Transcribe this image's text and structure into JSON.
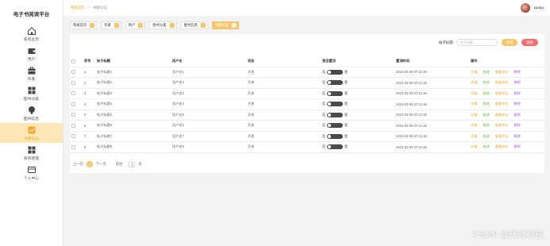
{
  "app_title": "电子书阅读平台",
  "breadcrumb": {
    "home": "系统首页",
    "sep": "/",
    "current": "书圈论坛"
  },
  "user": {
    "name": "xiaoju"
  },
  "sidebar": {
    "items": [
      {
        "label": "系统主页",
        "icon": "home-icon"
      },
      {
        "label": "用户",
        "icon": "wallet-icon"
      },
      {
        "label": "作者",
        "icon": "briefcase-icon"
      },
      {
        "label": "图书分类",
        "icon": "grid-icon"
      },
      {
        "label": "图书信息",
        "icon": "bulb-icon"
      },
      {
        "label": "书圈论坛",
        "icon": "chart-icon"
      },
      {
        "label": "系统管理",
        "icon": "grid-icon"
      },
      {
        "label": "个人中心",
        "icon": "card-icon"
      }
    ]
  },
  "tabs": [
    {
      "label": "系统首页"
    },
    {
      "label": "作者"
    },
    {
      "label": "用户"
    },
    {
      "label": "图书分类"
    },
    {
      "label": "图书信息"
    },
    {
      "label": "书圈论坛"
    }
  ],
  "search": {
    "label": "帖子标题",
    "placeholder": "帖子标题",
    "search_btn": "查询",
    "delete_btn": "删除"
  },
  "table": {
    "headers": [
      "序号",
      "帖子标题",
      "用户名",
      "状态",
      "是否置顶",
      "置顶时间",
      "操作"
    ],
    "rows": [
      {
        "idx": "1",
        "title": "帖子标题1",
        "user": "用户名1",
        "status": "开放",
        "time": "2024-03-09 07:21:46"
      },
      {
        "idx": "2",
        "title": "帖子标题2",
        "user": "用户名2",
        "status": "开放",
        "time": "2024-03-09 07:21:46"
      },
      {
        "idx": "3",
        "title": "帖子标题3",
        "user": "用户名3",
        "status": "开放",
        "time": "2024-03-09 07:21:46"
      },
      {
        "idx": "4",
        "title": "帖子标题4",
        "user": "用户名4",
        "status": "开放",
        "time": "2024-03-09 07:21:46"
      },
      {
        "idx": "5",
        "title": "帖子标题5",
        "user": "用户名5",
        "status": "开放",
        "time": "2024-03-09 07:21:46"
      },
      {
        "idx": "6",
        "title": "帖子标题6",
        "user": "用户名6",
        "status": "开放",
        "time": "2024-03-09 07:21:46"
      },
      {
        "idx": "7",
        "title": "帖子标题7",
        "user": "用户名7",
        "status": "开放",
        "time": "2024-03-09 07:21:46"
      },
      {
        "idx": "8",
        "title": "帖子标题8",
        "user": "用户名8",
        "status": "开放",
        "time": "2024-03-09 07:21:46"
      }
    ],
    "switch_left": "否",
    "switch_right": "是",
    "ops": {
      "detail": "详情",
      "edit": "修改",
      "comment": "查看评论",
      "delete": "删除"
    }
  },
  "pager": {
    "prev": "上一页",
    "current": "1",
    "next": "下一页",
    "goto": "前往",
    "page_input": "1",
    "page_unit": "页"
  },
  "watermark": "CSDN @辉时科技",
  "colors": {
    "accent": "#f8c56b",
    "danger": "#f56c6c",
    "edit": "#67c23a",
    "purple": "#a855f7"
  }
}
